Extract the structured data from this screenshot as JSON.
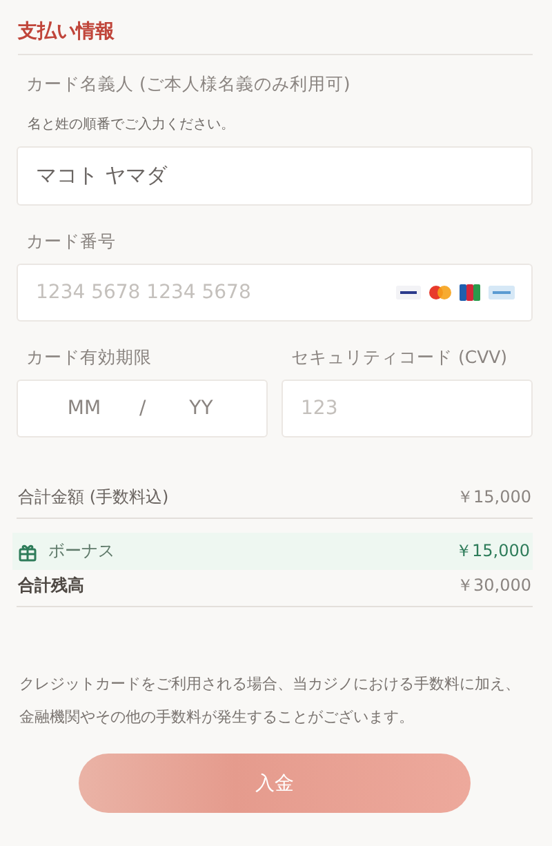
{
  "section_title": "支払い情報",
  "name_field": {
    "label": "カード名義人 (ご本人様名義のみ利用可)",
    "hint": "名と姓の順番でご入力ください。",
    "value": "マコト ヤマダ"
  },
  "card_number_field": {
    "label": "カード番号",
    "placeholder": "1234 5678 1234 5678"
  },
  "expiry_field": {
    "label": "カード有効期限",
    "month_placeholder": "MM",
    "separator": "/",
    "year_placeholder": "YY"
  },
  "cvv_field": {
    "label": "セキュリティコード (CVV)",
    "placeholder": "123"
  },
  "summary": [
    {
      "kind": "plain",
      "label": "合計金額 (手数料込)",
      "amount": "￥15,000"
    },
    {
      "kind": "bonus",
      "label": "ボーナス",
      "amount": "￥15,000"
    },
    {
      "kind": "total",
      "label": "合計残高",
      "amount": "￥30,000"
    }
  ],
  "notice": "クレジットカードをご利用される場合、当カジノにおける手数料に加え、金融機関やその他の手数料が発生することがございます。",
  "submit_button": "入金"
}
